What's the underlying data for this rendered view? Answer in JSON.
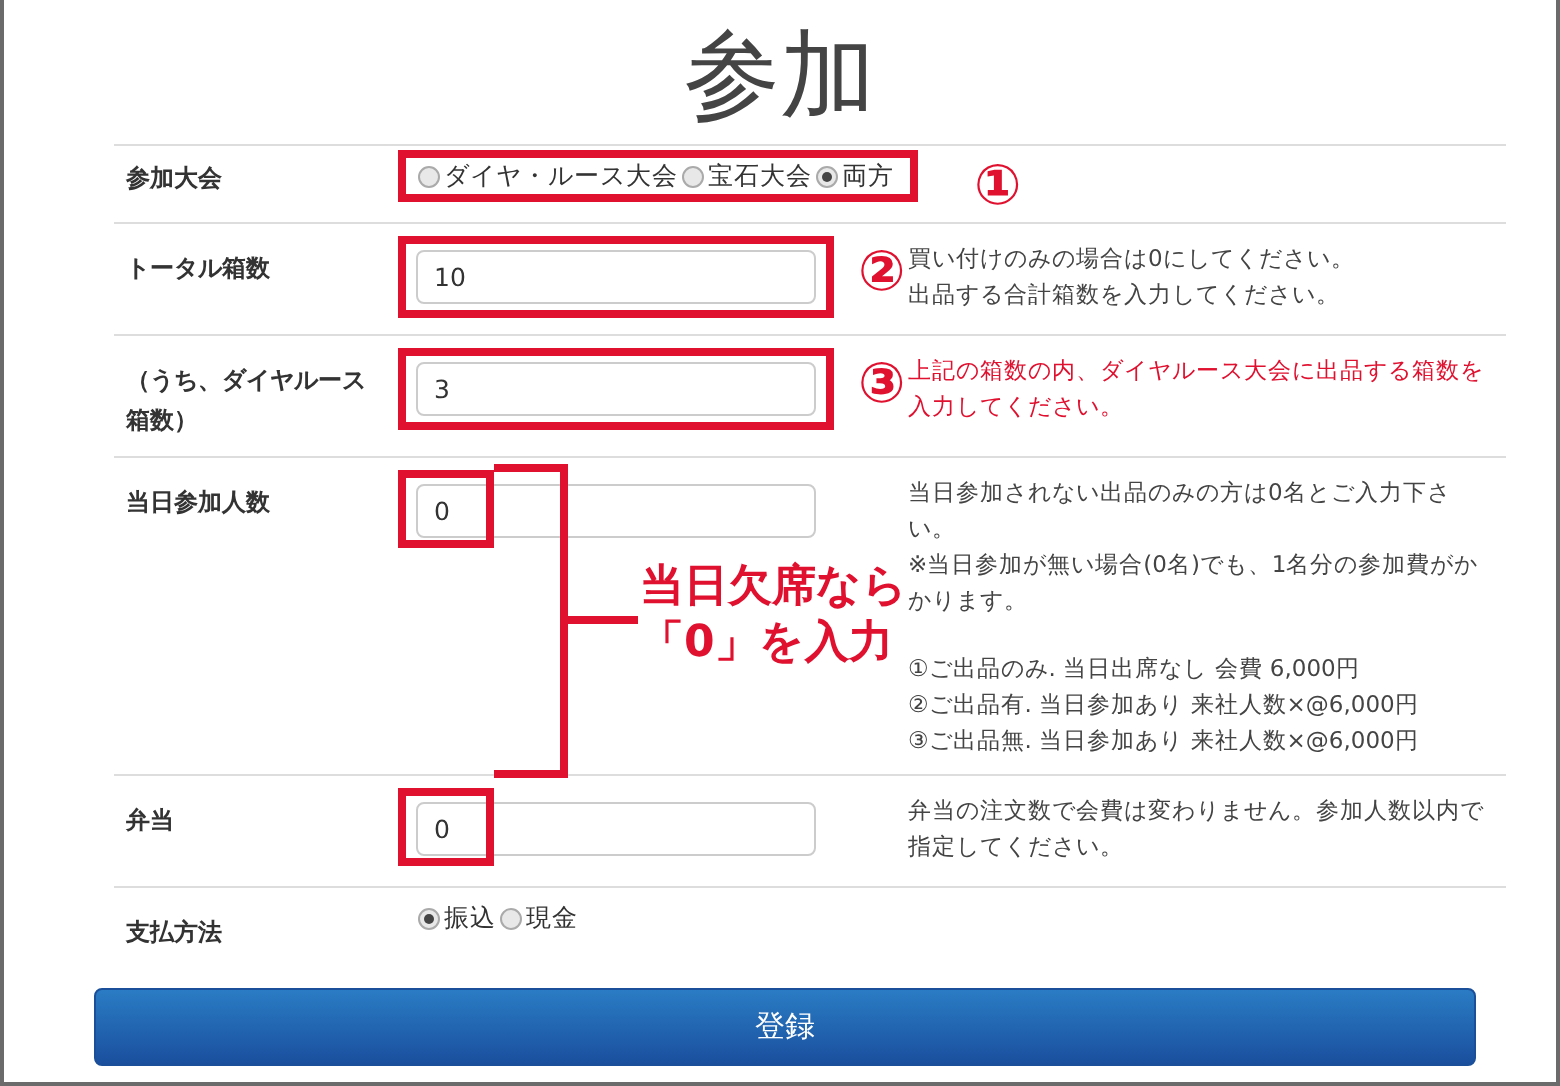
{
  "title": "参加",
  "rows": [
    {
      "label": "参加大会",
      "kind": "radio",
      "highlight": {
        "kind": "full"
      },
      "marker": "①",
      "options": [
        {
          "label": "ダイヤ・ルース大会",
          "selected": false
        },
        {
          "label": "宝石大会",
          "selected": false
        },
        {
          "label": "両方",
          "selected": true
        }
      ]
    },
    {
      "label": "トータル箱数",
      "kind": "input",
      "value": "10",
      "highlight": {
        "kind": "full"
      },
      "marker": "②",
      "emphasis": false,
      "help": [
        "買い付けのみの場合は0にしてください。",
        "出品する合計箱数を入力してください。"
      ]
    },
    {
      "label": "（うち、ダイヤルース箱数）",
      "kind": "input",
      "value": "3",
      "highlight": {
        "kind": "full"
      },
      "marker": "③",
      "emphasis": true,
      "help": [
        "上記の箱数の内、ダイヤルース大会に出品する箱数を入力してください。"
      ]
    },
    {
      "label": "当日参加人数",
      "kind": "input",
      "value": "0",
      "highlight": {
        "kind": "value"
      },
      "emphasis": false,
      "help": [
        "当日参加されない出品のみの方は0名とご入力下さい。",
        "※当日参加が無い場合(0名)でも、1名分の参加費がかかります。"
      ],
      "notes": [
        "①ご出品のみ. 当日出席なし 会費 6,000円",
        "②ご出品有. 当日参加あり 来社人数×@6,000円",
        "③ご出品無. 当日参加あり 来社人数×@6,000円"
      ]
    },
    {
      "label": "弁当",
      "kind": "input",
      "value": "0",
      "highlight": {
        "kind": "value"
      },
      "emphasis": false,
      "help": [
        "弁当の注文数で会費は変わりません。参加人数以内で指定してください。"
      ]
    },
    {
      "label": "支払方法",
      "kind": "radio",
      "options": [
        {
          "label": "振込",
          "selected": true
        },
        {
          "label": "現金",
          "selected": false
        }
      ]
    }
  ],
  "callout": [
    "当日欠席なら",
    "「0」を入力"
  ],
  "submit": "登録"
}
